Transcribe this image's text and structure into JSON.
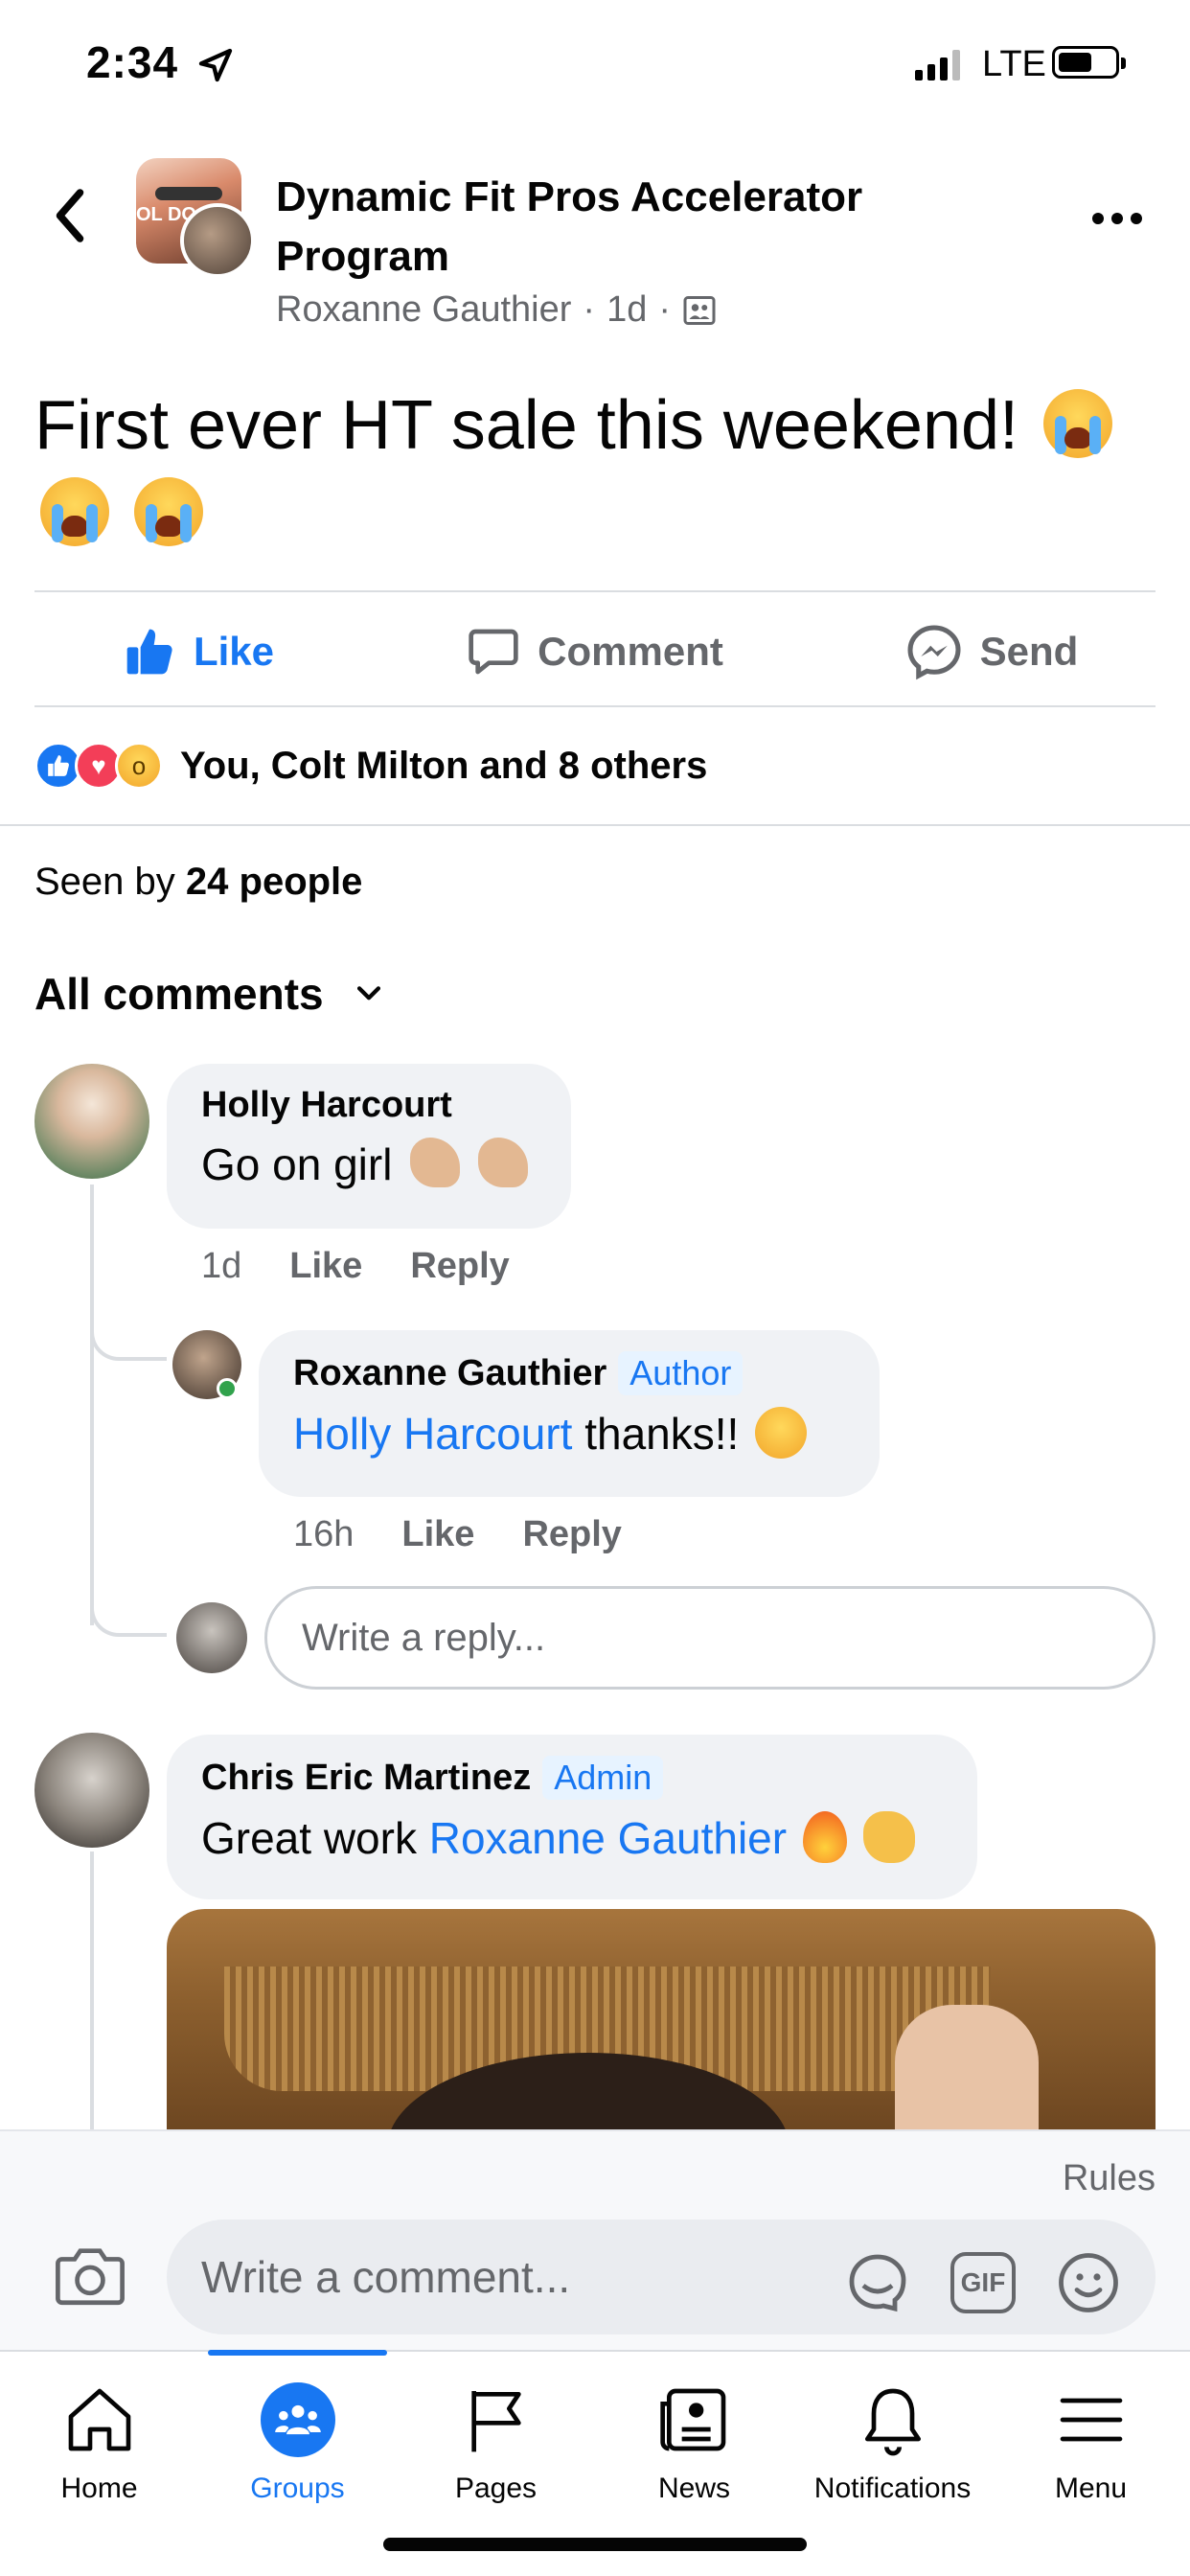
{
  "status_bar": {
    "time": "2:34",
    "network": "LTE"
  },
  "header": {
    "group_name": "Dynamic Fit Pros Accelerator Program",
    "author": "Roxanne Gauthier",
    "time": "1d",
    "audience_icon": "group-audience-icon"
  },
  "post": {
    "text": "First ever HT sale this weekend!"
  },
  "actions": {
    "like": "Like",
    "comment": "Comment",
    "send": "Send"
  },
  "reactions": {
    "summary": "You, Colt Milton and 8 others"
  },
  "seen": {
    "prefix": "Seen by",
    "count": "24 people"
  },
  "comments_filter": "All comments",
  "comments": [
    {
      "author": "Holly Harcourt",
      "text": "Go on girl",
      "time": "1d",
      "like": "Like",
      "reply": "Reply"
    },
    {
      "author": "Roxanne Gauthier",
      "badge": "Author",
      "mention": "Holly Harcourt",
      "text": "thanks!!",
      "time": "16h",
      "like": "Like",
      "reply": "Reply"
    },
    {
      "author": "Chris Eric Martinez",
      "badge": "Admin",
      "text_prefix": "Great work",
      "mention": "Roxanne Gauthier"
    }
  ],
  "reply_input": {
    "placeholder": "Write a reply..."
  },
  "composer": {
    "rules": "Rules",
    "placeholder": "Write a comment...",
    "gif": "GIF"
  },
  "tabs": [
    {
      "label": "Home",
      "icon": "home-icon"
    },
    {
      "label": "Groups",
      "icon": "groups-icon",
      "active": true
    },
    {
      "label": "Pages",
      "icon": "flag-icon"
    },
    {
      "label": "News",
      "icon": "news-icon"
    },
    {
      "label": "Notifications",
      "icon": "bell-icon"
    },
    {
      "label": "Menu",
      "icon": "menu-icon"
    }
  ],
  "colors": {
    "accent": "#1877f2",
    "secondary_text": "#65676b",
    "bubble": "#f0f2f5"
  }
}
